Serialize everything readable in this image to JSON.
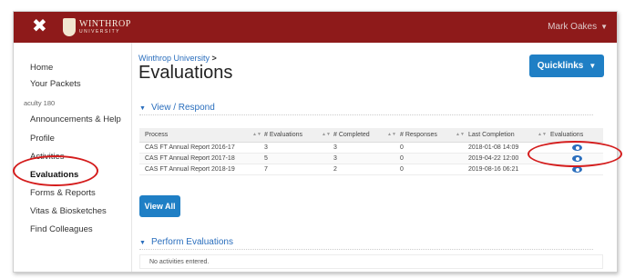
{
  "header": {
    "close_glyph": "✖",
    "logo_text": "WINTHROP",
    "logo_sub": "UNIVERSITY",
    "user_name": "Mark Oakes",
    "colors": {
      "bar": "#8e1a1a",
      "accent": "#1f7fc5",
      "annotation": "#d41c1c"
    }
  },
  "sidebar": {
    "items": [
      {
        "label": "Home"
      },
      {
        "label": "Your Packets"
      },
      {
        "label": "aculty 180"
      },
      {
        "label": "Announcements & Help"
      },
      {
        "label": "Profile"
      },
      {
        "label": "Activities"
      },
      {
        "label": "Evaluations"
      },
      {
        "label": "Forms & Reports"
      },
      {
        "label": "Vitas & Biosketches"
      },
      {
        "label": "Find Colleagues"
      }
    ],
    "active": "Evaluations"
  },
  "main": {
    "breadcrumb": "Winthrop University",
    "breadcrumb_sep": ">",
    "title": "Evaluations",
    "quicklinks_label": "Quicklinks",
    "view_section": "View / Respond",
    "table": {
      "columns": [
        "Process",
        "# Evaluations",
        "# Completed",
        "# Responses",
        "Last Completion",
        "Evaluations"
      ],
      "rows": [
        {
          "process": "CAS FT Annual Report 2016-17",
          "evaluations": "3",
          "completed": "3",
          "responses": "0",
          "last_completion": "2018-01-08 14:09",
          "icon": "eye-icon"
        },
        {
          "process": "CAS FT Annual Report 2017-18",
          "evaluations": "5",
          "completed": "3",
          "responses": "0",
          "last_completion": "2019-04-22 12:00",
          "icon": "eye-icon"
        },
        {
          "process": "CAS FT Annual Report 2018-19",
          "evaluations": "7",
          "completed": "2",
          "responses": "0",
          "last_completion": "2019-08-16 06:21",
          "icon": "eye-icon"
        }
      ]
    },
    "view_all_label": "View All",
    "perform_section": "Perform Evaluations",
    "empty_message": "No activities entered."
  }
}
